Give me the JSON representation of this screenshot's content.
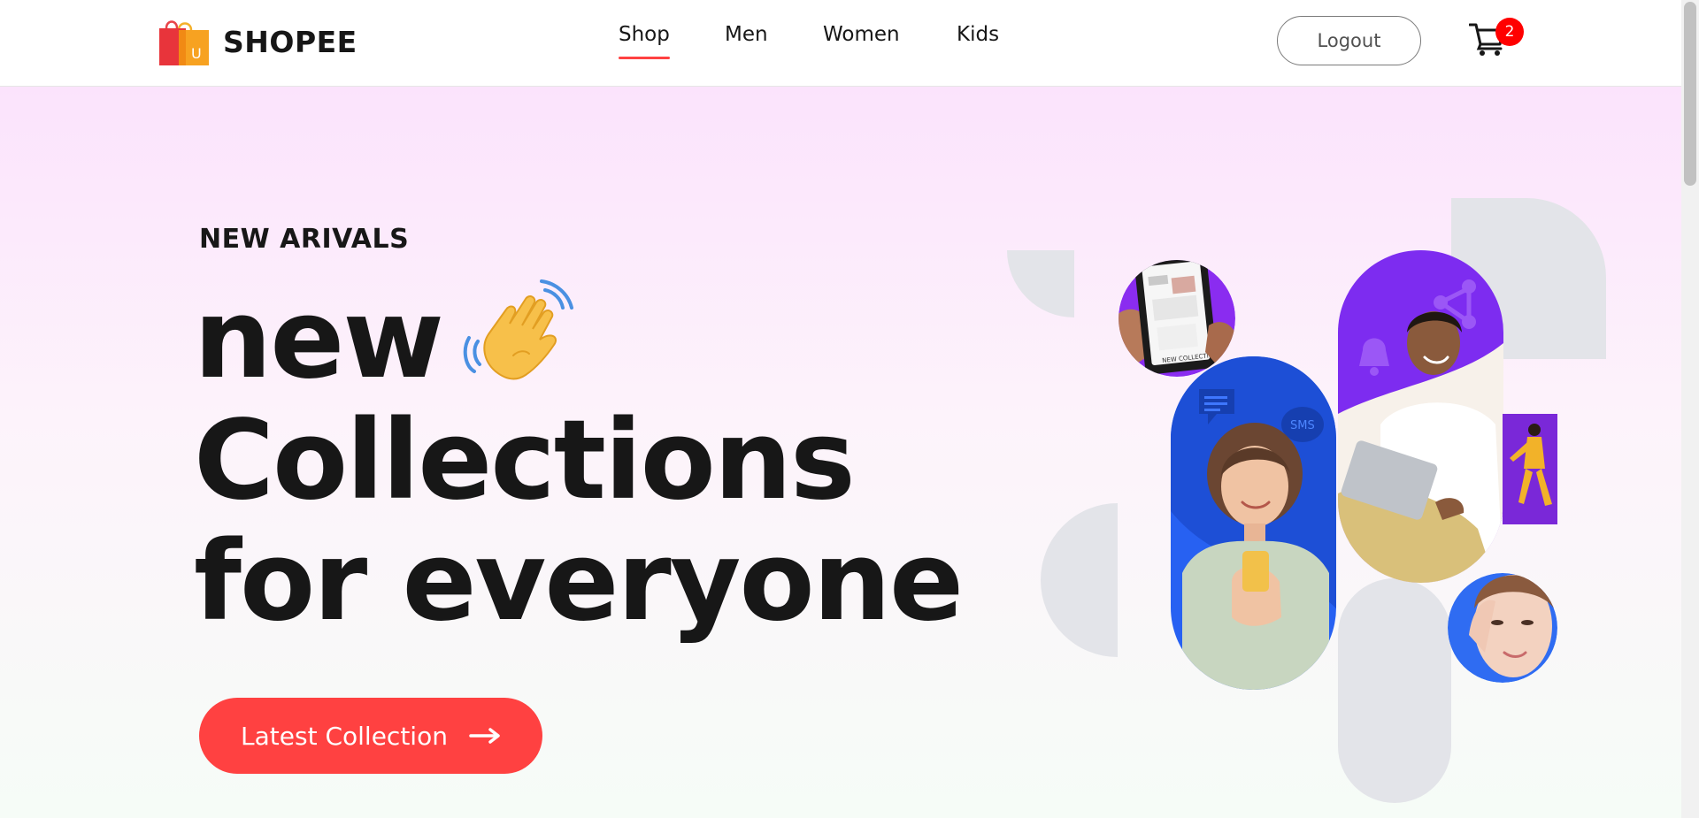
{
  "brand": {
    "name": "SHOPEE",
    "logo_icon": "shopping-bag-icon",
    "logo_letter": "U"
  },
  "nav": {
    "links": [
      {
        "label": "Shop",
        "active": true
      },
      {
        "label": "Men",
        "active": false
      },
      {
        "label": "Women",
        "active": false
      },
      {
        "label": "Kids",
        "active": false
      }
    ]
  },
  "header": {
    "logout_label": "Logout",
    "cart_icon": "cart-icon",
    "cart_count": "2"
  },
  "hero": {
    "eyebrow": "NEW ARIVALS",
    "headline": {
      "line1": "new",
      "line2": "Collections",
      "line3": "for everyone"
    },
    "hand_icon": "waving-hand-icon",
    "cta_label": "Latest Collection",
    "cta_icon": "arrow-right-icon",
    "art_badge_sms": "SMS",
    "tablet_caption": "NEW COLLECTION"
  },
  "colors": {
    "accent": "#ff4141",
    "text": "#171717",
    "purple": "#7f2cf2",
    "blue": "#1f5ff0",
    "shape_gray": "#e3e4e9",
    "hero_top": "#fbe3fc",
    "hero_bottom": "#f6fcf7"
  }
}
